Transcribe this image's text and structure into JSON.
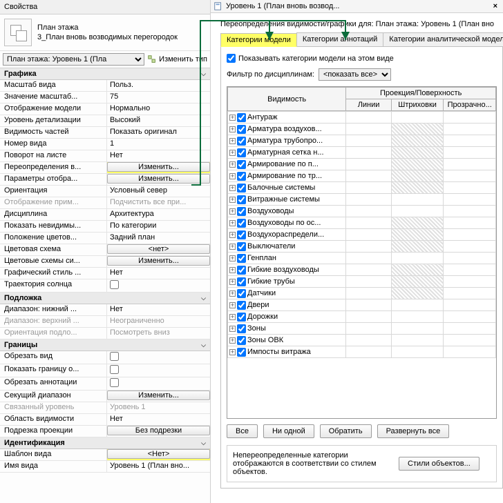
{
  "properties": {
    "title": "Свойства",
    "header": {
      "type": "План этажа",
      "name": "3_План вновь возводимых перегородок"
    },
    "selector": "План этажа: Уровень 1 (Пла",
    "edit_type": "Изменить тип",
    "groups": [
      {
        "name": "Графика",
        "rows": [
          {
            "label": "Масштаб вида",
            "value": "Польз."
          },
          {
            "label": "Значение масштаб...",
            "value": "75"
          },
          {
            "label": "Отображение модели",
            "value": "Нормально"
          },
          {
            "label": "Уровень детализации",
            "value": "Высокий"
          },
          {
            "label": "Видимость частей",
            "value": "Показать оригинал"
          },
          {
            "label": "Номер вида",
            "value": "1"
          },
          {
            "label": "Поворот на листе",
            "value": "Нет"
          },
          {
            "label": "Переопределения в...",
            "value": "Изменить...",
            "btn": true,
            "hl": true
          },
          {
            "label": "Параметры отобра...",
            "value": "Изменить...",
            "btn": true
          },
          {
            "label": "Ориентация",
            "value": "Условный север"
          },
          {
            "label": "Отображение прим...",
            "value": "Подчистить все при...",
            "disabled": true
          },
          {
            "label": "Дисциплина",
            "value": "Архитектура"
          },
          {
            "label": "Показать невидимы...",
            "value": "По категории"
          },
          {
            "label": "Положение цветов...",
            "value": "Задний план"
          },
          {
            "label": "Цветовая схема",
            "value": "<нет>",
            "btn": true
          },
          {
            "label": "Цветовые схемы си...",
            "value": "Изменить...",
            "btn": true
          },
          {
            "label": "Графический стиль ...",
            "value": "Нет"
          },
          {
            "label": "Траектория солнца",
            "value": "",
            "check": true
          }
        ]
      },
      {
        "name": "Подложка",
        "rows": [
          {
            "label": "Диапазон: нижний ...",
            "value": "Нет"
          },
          {
            "label": "Диапазон: верхний ...",
            "value": "Неограниченно",
            "disabled": true
          },
          {
            "label": "Ориентация подло...",
            "value": "Посмотреть вниз",
            "disabled": true
          }
        ]
      },
      {
        "name": "Границы",
        "rows": [
          {
            "label": "Обрезать вид",
            "value": "",
            "check": true
          },
          {
            "label": "Показать границу о...",
            "value": "",
            "check": true
          },
          {
            "label": "Обрезать аннотации",
            "value": "",
            "check": true
          },
          {
            "label": "Секущий диапазон",
            "value": "Изменить...",
            "btn": true
          },
          {
            "label": "Связанный уровень",
            "value": "Уровень 1",
            "disabled": true
          },
          {
            "label": "Область видимости",
            "value": "Нет"
          },
          {
            "label": "Подрезка проекции",
            "value": "Без подрезки",
            "btn": true
          }
        ]
      },
      {
        "name": "Идентификация",
        "rows": [
          {
            "label": "Шаблон вида",
            "value": "<Нет>",
            "btn": true,
            "hl_template": true
          },
          {
            "label": "Имя вида",
            "value": "Уровень 1 (План вно..."
          }
        ]
      }
    ]
  },
  "tab": {
    "name": "Уровень 1 (План вновь возвод...",
    "close": "×"
  },
  "dialog": {
    "title": "Переопределения видимости/графики для: План этажа: Уровень 1 (План вно",
    "tabs": [
      "Категории модели",
      "Категории аннотаций",
      "Категории аналитической модели"
    ],
    "show_cats": "Показывать категории модели на этом виде",
    "filter_label": "Фильтр по дисциплинам:",
    "filter_value": "<показать все>",
    "headers": {
      "visibility": "Видимость",
      "projection": "Проекция/Поверхность",
      "lines": "Линии",
      "hatching": "Штриховки",
      "transparency": "Прозрачно..."
    },
    "categories": [
      {
        "name": "Антураж",
        "hatch": false
      },
      {
        "name": "Арматура воздухов...",
        "hatch": true
      },
      {
        "name": "Арматура трубопро...",
        "hatch": true
      },
      {
        "name": "Арматурная сетка н...",
        "hatch": true
      },
      {
        "name": "Армирование по п...",
        "hatch": true
      },
      {
        "name": "Армирование по тр...",
        "hatch": true
      },
      {
        "name": "Балочные системы",
        "hatch": true
      },
      {
        "name": "Витражные системы",
        "hatch": false
      },
      {
        "name": "Воздуховоды",
        "hatch": false
      },
      {
        "name": "Воздуховоды по ос...",
        "hatch": true
      },
      {
        "name": "Воздухораспредели...",
        "hatch": true
      },
      {
        "name": "Выключатели",
        "hatch": true
      },
      {
        "name": "Генплан",
        "hatch": false
      },
      {
        "name": "Гибкие воздуховоды",
        "hatch": true
      },
      {
        "name": "Гибкие трубы",
        "hatch": true
      },
      {
        "name": "Датчики",
        "hatch": true
      },
      {
        "name": "Двери",
        "hatch": false
      },
      {
        "name": "Дорожки",
        "hatch": false
      },
      {
        "name": "Зоны",
        "hatch": false
      },
      {
        "name": "Зоны ОВК",
        "hatch": false
      },
      {
        "name": "Импосты витража",
        "hatch": false
      }
    ],
    "buttons": {
      "all": "Все",
      "none": "Ни одной",
      "invert": "Обратить",
      "expand": "Развернуть все"
    },
    "footer_note": "Непереопределенные категории отображаются в соответствии со стилем объектов.",
    "styles_btn": "Стили объектов..."
  }
}
